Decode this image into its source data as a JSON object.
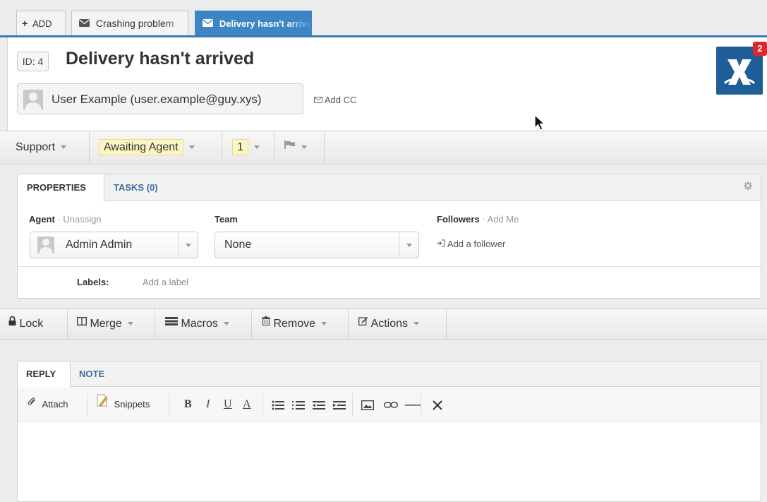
{
  "tabs": {
    "add_label": "ADD",
    "items": [
      {
        "label": "Crashing problem"
      },
      {
        "label": "Delivery hasn't arrived"
      }
    ]
  },
  "ticket": {
    "id_label": "ID: 4",
    "title": "Delivery hasn't arrived",
    "user": "User Example (user.example@guy.xys)",
    "add_cc": "Add CC",
    "notification_count": "2"
  },
  "status": {
    "department": "Support",
    "status": "Awaiting Agent",
    "urgency": "1"
  },
  "properties": {
    "tabs": [
      "PROPERTIES",
      "TASKS (0)"
    ],
    "agent_label": "Agent",
    "agent_action": "Unassign",
    "agent_value": "Admin Admin",
    "team_label": "Team",
    "team_value": "None",
    "followers_label": "Followers",
    "followers_action": "Add Me",
    "add_follower": "Add a follower",
    "labels_label": "Labels:",
    "labels_placeholder": "Add a label"
  },
  "actions": {
    "lock": "Lock",
    "merge": "Merge",
    "macros": "Macros",
    "remove": "Remove",
    "actions": "Actions"
  },
  "reply": {
    "tabs": [
      "REPLY",
      "NOTE"
    ],
    "attach": "Attach",
    "snippets": "Snippets",
    "format": [
      "B",
      "I",
      "U",
      "A"
    ]
  },
  "colors": {
    "accent": "#3d86c6",
    "logo": "#1f5d96",
    "badge": "#e0262b",
    "status_highlight": "#fbf6c3"
  }
}
